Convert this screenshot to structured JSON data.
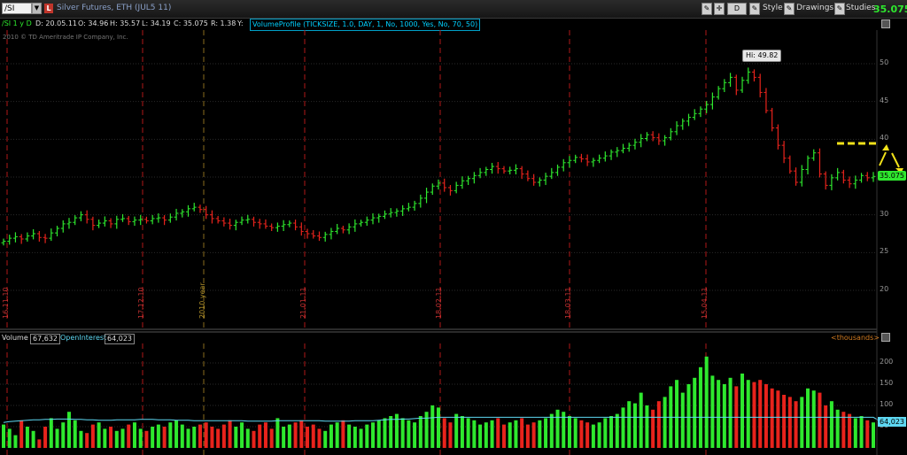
{
  "header": {
    "symbol": "/SI",
    "symbol_badge": "L",
    "description": "Silver Futures, ETH (JUL5 11)",
    "buttons": {
      "style": "Style",
      "drawings": "Drawings",
      "studies": "Studies",
      "d_button": "D"
    },
    "last_price": "35.075"
  },
  "infobar": {
    "period": "/SI 1 y D",
    "date": "D: 20.05.11",
    "open": "O: 34.96",
    "high": "H: 35.57",
    "low": "L: 34.19",
    "close": "C: 35.075",
    "range": "R: 1.38",
    "y": "Y:",
    "study": "VolumeProfile (TICKSIZE, 1.0, DAY, 1, No, 1000, Yes, No, 70, 50)"
  },
  "copyright": "2010 © TD Ameritrade IP Company, Inc.",
  "volume_bar": {
    "volume_label": "Volume",
    "volume_value": "67,632",
    "oi_label": "OpenInterest",
    "oi_value": "64,023",
    "units": "<thousands>"
  },
  "price_labels": {
    "high": "Hi: 49.82",
    "current": "35.075",
    "current_oi": "64,023"
  },
  "colors": {
    "up": "#2ee82e",
    "down": "#e8231c",
    "oi_line": "#5ed8f2",
    "grid": "#2a2a2a",
    "date_line": "#b01818",
    "dash_line": "#f2e21a"
  },
  "chart_data": {
    "type": "line",
    "title": "Silver Futures, ETH (JUL5 11)",
    "price_axis": {
      "ticks": [
        20,
        25,
        30,
        35,
        40,
        45,
        50
      ],
      "ylim": [
        17,
        53
      ]
    },
    "volume_axis": {
      "ticks": [
        50,
        100,
        150,
        200
      ],
      "ylim": [
        0,
        230
      ]
    },
    "date_markers": [
      "16.11.10",
      "17.12.10",
      "2010 year",
      "21.01.11",
      "18.02.11",
      "18.03.11",
      "15.04.11"
    ],
    "series": [
      {
        "name": "/SI",
        "values": [
          26.5,
          26.9,
          27.1,
          26.8,
          27.2,
          27.5,
          27.0,
          26.9,
          27.6,
          28.2,
          28.8,
          29.0,
          29.6,
          30.0,
          29.4,
          28.6,
          28.9,
          29.2,
          28.8,
          29.4,
          29.5,
          29.1,
          29.3,
          29.4,
          29.2,
          29.5,
          29.6,
          29.3,
          29.7,
          30.2,
          30.4,
          30.8,
          31.0,
          30.7,
          30.0,
          29.5,
          29.2,
          28.9,
          28.6,
          29.0,
          29.3,
          29.4,
          29.0,
          28.8,
          28.5,
          28.3,
          28.5,
          28.7,
          28.9,
          28.4,
          27.8,
          27.5,
          27.2,
          27.0,
          27.4,
          27.8,
          28.2,
          28.0,
          28.4,
          28.8,
          29.0,
          29.3,
          29.6,
          29.8,
          30.1,
          30.3,
          30.5,
          30.8,
          31.0,
          31.5,
          32.2,
          33.0,
          33.8,
          34.2,
          33.6,
          33.2,
          33.9,
          34.5,
          34.8,
          35.2,
          35.6,
          36.0,
          36.4,
          36.1,
          35.8,
          35.9,
          36.1,
          35.4,
          34.8,
          34.3,
          34.6,
          35.1,
          35.6,
          36.3,
          36.9,
          37.2,
          37.6,
          37.4,
          37.0,
          37.2,
          37.5,
          37.8,
          38.3,
          38.5,
          38.8,
          39.2,
          39.6,
          40.1,
          40.6,
          40.2,
          39.8,
          40.2,
          41.0,
          41.8,
          42.4,
          42.9,
          43.4,
          44.0,
          44.6,
          45.6,
          46.7,
          47.5,
          48.2,
          46.5,
          47.8,
          48.9,
          48.2,
          46.2,
          43.8,
          41.5,
          39.2,
          37.5,
          35.8,
          34.3,
          36.0,
          37.5,
          38.2,
          35.4,
          33.9,
          34.9,
          35.6,
          34.6,
          34.1,
          34.6,
          35.2,
          34.9,
          35.08
        ]
      },
      {
        "name": "Volume",
        "values": [
          55,
          45,
          30,
          65,
          50,
          40,
          20,
          50,
          70,
          45,
          60,
          85,
          65,
          40,
          35,
          55,
          60,
          45,
          50,
          40,
          45,
          55,
          60,
          45,
          40,
          50,
          55,
          50,
          60,
          65,
          55,
          45,
          50,
          55,
          60,
          50,
          45,
          55,
          65,
          50,
          60,
          45,
          40,
          55,
          60,
          45,
          70,
          50,
          55,
          60,
          65,
          50,
          55,
          45,
          40,
          55,
          60,
          65,
          55,
          50,
          45,
          55,
          60,
          65,
          70,
          75,
          80,
          70,
          65,
          60,
          75,
          85,
          100,
          95,
          70,
          60,
          80,
          75,
          70,
          65,
          55,
          60,
          65,
          70,
          55,
          60,
          65,
          70,
          55,
          60,
          65,
          70,
          80,
          90,
          85,
          75,
          70,
          65,
          60,
          55,
          60,
          70,
          75,
          80,
          95,
          110,
          105,
          130,
          100,
          90,
          110,
          120,
          145,
          160,
          130,
          150,
          165,
          190,
          215,
          170,
          160,
          150,
          165,
          145,
          175,
          160,
          155,
          160,
          150,
          140,
          135,
          125,
          120,
          110,
          120,
          140,
          135,
          130,
          100,
          110,
          90,
          85,
          80,
          70,
          75,
          65,
          60,
          67.6
        ]
      },
      {
        "name": "OpenInterest",
        "values": [
          60,
          62,
          63,
          64,
          65,
          66,
          66,
          67,
          67,
          68,
          68,
          68,
          67,
          67,
          66,
          66,
          65,
          65,
          65,
          66,
          66,
          66,
          66,
          67,
          67,
          67,
          66,
          66,
          66,
          65,
          65,
          65,
          64,
          64,
          64,
          64,
          64,
          64,
          64,
          64,
          64,
          63,
          63,
          63,
          63,
          63,
          64,
          64,
          64,
          64,
          64,
          64,
          64,
          64,
          63,
          63,
          63,
          63,
          63,
          64,
          64,
          64,
          64,
          65,
          66,
          67,
          67,
          68,
          68,
          69,
          70,
          70,
          71,
          72,
          72,
          72,
          72,
          72,
          72,
          72,
          72,
          72,
          72,
          72,
          72,
          72,
          72,
          72,
          72,
          72,
          72,
          72,
          72,
          72,
          72,
          72,
          72,
          72,
          72,
          72,
          72,
          72,
          72,
          72,
          72,
          72,
          72,
          72,
          72,
          72,
          72,
          72,
          72,
          72,
          72,
          72,
          72,
          72,
          72,
          72,
          72,
          72,
          72,
          72,
          72,
          72,
          72,
          72,
          72,
          72,
          72,
          72,
          72,
          72,
          72,
          72,
          72,
          72,
          72,
          72,
          72,
          72,
          72,
          72,
          72,
          72,
          72,
          64
        ]
      }
    ]
  }
}
